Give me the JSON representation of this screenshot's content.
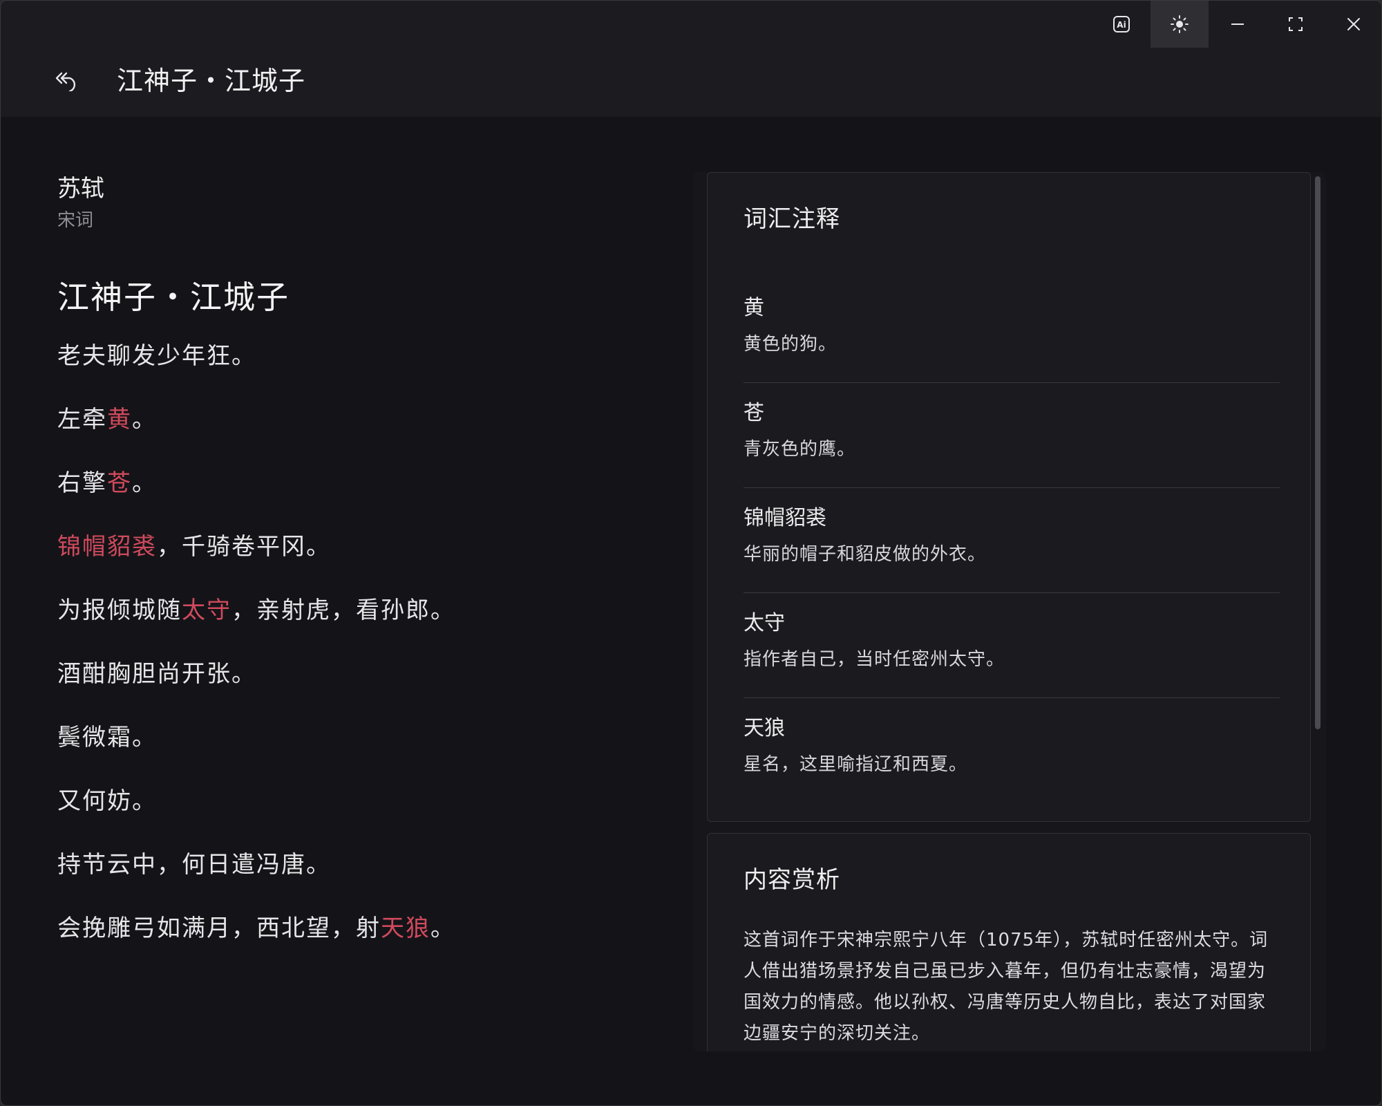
{
  "window": {
    "caption_buttons": [
      {
        "name": "ai-icon"
      },
      {
        "name": "sun-icon"
      },
      {
        "name": "minimize-icon"
      },
      {
        "name": "maximize-icon"
      },
      {
        "name": "close-icon"
      }
    ]
  },
  "header": {
    "title": "江神子・江城子"
  },
  "poem": {
    "author": "苏轼",
    "dynasty": "宋词",
    "title": "江神子・江城子",
    "lines": [
      [
        {
          "t": "老夫聊发少年狂。",
          "h": false
        }
      ],
      [
        {
          "t": "左牵",
          "h": false
        },
        {
          "t": "黄",
          "h": true
        },
        {
          "t": "。",
          "h": false
        }
      ],
      [
        {
          "t": "右擎",
          "h": false
        },
        {
          "t": "苍",
          "h": true
        },
        {
          "t": "。",
          "h": false
        }
      ],
      [
        {
          "t": "锦帽貂裘",
          "h": true
        },
        {
          "t": "，千骑卷平冈。",
          "h": false
        }
      ],
      [
        {
          "t": "为报倾城随",
          "h": false
        },
        {
          "t": "太守",
          "h": true
        },
        {
          "t": "，亲射虎，看孙郎。",
          "h": false
        }
      ],
      [
        {
          "t": "酒酣胸胆尚开张。",
          "h": false
        }
      ],
      [
        {
          "t": "鬓微霜。",
          "h": false
        }
      ],
      [
        {
          "t": "又何妨。",
          "h": false
        }
      ],
      [
        {
          "t": "持节云中，何日遣冯唐。",
          "h": false
        }
      ],
      [
        {
          "t": "会挽雕弓如满月，西北望，射",
          "h": false
        },
        {
          "t": "天狼",
          "h": true
        },
        {
          "t": "。",
          "h": false
        }
      ]
    ],
    "highlight_color": "#d04a5d"
  },
  "glossary": {
    "title": "词汇注释",
    "items": [
      {
        "term": "黄",
        "definition": "黄色的狗。"
      },
      {
        "term": "苍",
        "definition": "青灰色的鹰。"
      },
      {
        "term": "锦帽貂裘",
        "definition": "华丽的帽子和貂皮做的外衣。"
      },
      {
        "term": "太守",
        "definition": "指作者自己，当时任密州太守。"
      },
      {
        "term": "天狼",
        "definition": "星名，这里喻指辽和西夏。"
      }
    ]
  },
  "analysis": {
    "title": "内容赏析",
    "text": "这首词作于宋神宗熙宁八年（1075年），苏轼时任密州太守。词人借出猎场景抒发自己虽已步入暮年，但仍有壮志豪情，渴望为国效力的情感。他以孙权、冯唐等历史人物自比，表达了对国家边疆安宁的深切关注。"
  }
}
